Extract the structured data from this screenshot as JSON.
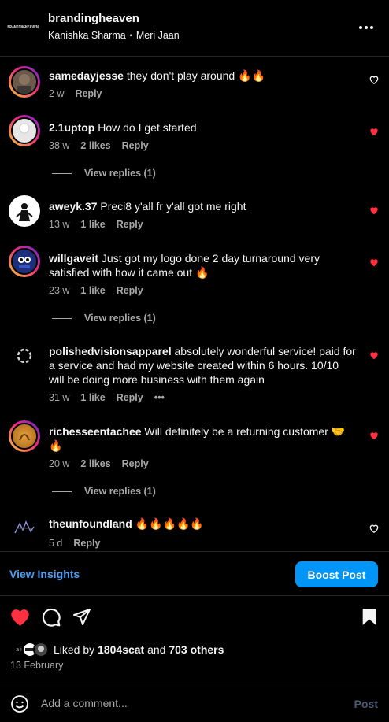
{
  "header": {
    "logo_text": "BRANDINGHEAVEN",
    "account": "brandingheaven",
    "author": "Kanishka Sharma",
    "separator": "•",
    "song": "Meri Jaan",
    "more_icon": "more-horizontal-icon"
  },
  "comments": [
    {
      "user": "samedayjesse",
      "text": "they don't play around 🔥🔥",
      "time": "2 w",
      "likes": "",
      "reply": "Reply",
      "liked": false
    },
    {
      "user": "2.1uptop",
      "text": "How do I get started",
      "time": "38 w",
      "likes": "2 likes",
      "reply": "Reply",
      "liked": true,
      "view_replies": "View replies (1)"
    },
    {
      "user": "aweyk.37",
      "text": "Preci8 y'all fr y'all got me right",
      "time": "13 w",
      "likes": "1 like",
      "reply": "Reply",
      "liked": true
    },
    {
      "user": "willgaveit",
      "text": "Just got my logo done 2 day turnaround very satisfied with how it came out 🔥",
      "time": "23 w",
      "likes": "1 like",
      "reply": "Reply",
      "liked": true,
      "view_replies": "View replies (1)"
    },
    {
      "user": "polishedvisionsapparel",
      "text": "absolutely wonderful service! paid for a service and had my website created within 6 hours. 10/10 will be doing more business with them again",
      "time": "31 w",
      "likes": "1 like",
      "reply": "Reply",
      "more": "•••",
      "liked": true
    },
    {
      "user": "richesseentachee",
      "text": "Will definitely be a returning customer 🤝🔥",
      "time": "20 w",
      "likes": "2 likes",
      "reply": "Reply",
      "liked": true,
      "view_replies": "View replies (1)"
    },
    {
      "user": "theunfoundland",
      "text": "🔥🔥🔥🔥🔥",
      "time": "5 d",
      "likes": "",
      "reply": "Reply",
      "liked": false
    }
  ],
  "insights": {
    "view_label": "View Insights",
    "boost_label": "Boost Post"
  },
  "actions": {
    "like_icon": "heart-filled-icon",
    "comment_icon": "comment-icon",
    "share_icon": "share-icon",
    "save_icon": "bookmark-filled-icon"
  },
  "likes": {
    "prefix": "Liked by",
    "user": "1804scat",
    "mid": "and",
    "others": "703 others"
  },
  "post_date": "13 February",
  "comment_box": {
    "placeholder": "Add a comment...",
    "post_label": "Post"
  },
  "colors": {
    "accent_blue": "#0095f6",
    "link_blue": "#4a9ff5",
    "heart_red": "#ff3040",
    "muted": "#a8a8a8"
  }
}
